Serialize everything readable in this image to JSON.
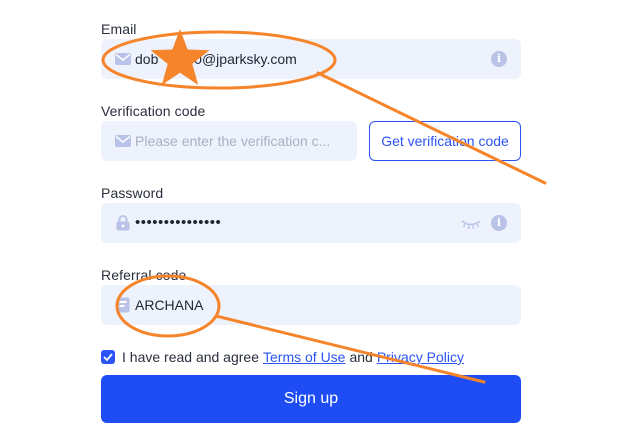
{
  "email": {
    "label": "Email",
    "value": "dob          00@jparksky.com"
  },
  "verification": {
    "label": "Verification code",
    "placeholder": "Please enter the verification c...",
    "button_label": "Get verification code"
  },
  "password": {
    "label": "Password",
    "value": "•••••••••••••••"
  },
  "referral": {
    "label": "Referral code",
    "value": "ARCHANA"
  },
  "agreement": {
    "checked": true,
    "prefix": "I have read and agree",
    "terms_link": "Terms of Use",
    "conjunction": "and",
    "privacy_link": "Privacy Policy"
  },
  "signup": {
    "label": "Sign up"
  },
  "colors": {
    "accent": "#1f4df5",
    "field_bg": "#eef2fd",
    "annotation": "#f5842a"
  },
  "icons": {
    "email": "mail-icon",
    "verification": "mail-icon",
    "password": "lock-icon",
    "referral": "ticket-icon",
    "info": "info-icon",
    "eye": "eye-closed-icon",
    "check": "check-icon",
    "annotation": "star-icon"
  }
}
